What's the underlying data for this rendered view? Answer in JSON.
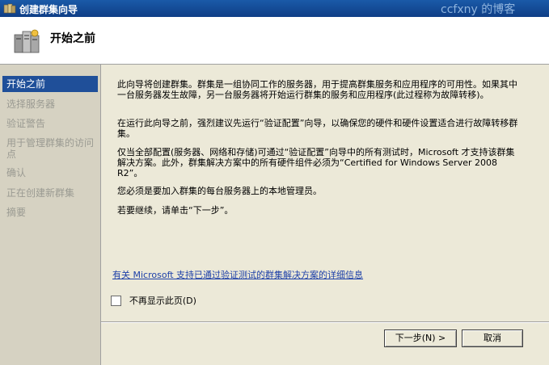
{
  "window": {
    "title": "创建群集向导",
    "watermark": "ccfxny 的博客"
  },
  "header": {
    "title": "开始之前"
  },
  "nav": {
    "items": [
      {
        "label": "开始之前"
      },
      {
        "label": "选择服务器"
      },
      {
        "label": "验证警告"
      },
      {
        "label": "用于管理群集的访问点"
      },
      {
        "label": "确认"
      },
      {
        "label": "正在创建新群集"
      },
      {
        "label": "摘要"
      }
    ]
  },
  "content": {
    "paragraphs": [
      "此向导将创建群集。群集是一组协同工作的服务器，用于提高群集服务和应用程序的可用性。如果其中一台服务器发生故障，另一台服务器将开始运行群集的服务和应用程序(此过程称为故障转移)。",
      "在运行此向导之前，强烈建议先运行“验证配置”向导，以确保您的硬件和硬件设置适合进行故障转移群集。",
      "仅当全部配置(服务器、网络和存储)可通过“验证配置”向导中的所有测试时，Microsoft 才支持该群集解决方案。此外，群集解决方案中的所有硬件组件必须为“Certified for Windows Server 2008 R2”。",
      "您必须是要加入群集的每台服务器上的本地管理员。",
      "若要继续，请单击“下一步”。"
    ],
    "link": "有关 Microsoft 支持已通过验证测试的群集解决方案的详细信息",
    "checkbox_label": "不再显示此页(D)",
    "checkbox_checked": false
  },
  "buttons": {
    "next": "下一步(N) >",
    "cancel": "取消"
  }
}
